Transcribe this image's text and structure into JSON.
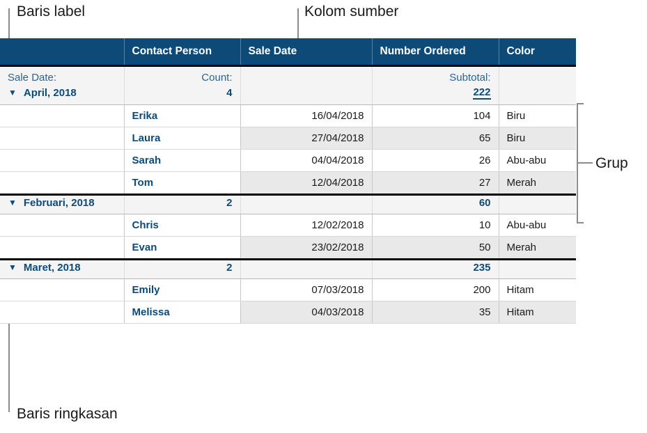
{
  "annotations": [
    {
      "id": "baris-label",
      "text": "Baris label"
    },
    {
      "id": "kolom-sumber",
      "text": "Kolom sumber"
    },
    {
      "id": "grup",
      "text": "Grup"
    },
    {
      "id": "baris-ringkasan",
      "text": "Baris ringkasan"
    }
  ],
  "colors": {
    "header_blue": "#0d4a78",
    "summary_text_blue": "#0d4a78",
    "label_text_blue": "#2c6391",
    "row_shade": "#e9e9e9",
    "summary_shade": "#f4f4f4",
    "leader_gray": "#8b8b8b"
  },
  "table": {
    "headers": [
      "",
      "Contact Person",
      "Sale Date",
      "Number Ordered",
      "Color"
    ],
    "label_row": {
      "col1": "Sale Date:",
      "col2": "Count:",
      "col3": "",
      "col4": "Subtotal:",
      "col5": ""
    },
    "disclosure_icon": "▼",
    "groups": [
      {
        "name": "April, 2018",
        "count": "4",
        "subtotal": "222",
        "subtotal_underlined": true,
        "rows": [
          {
            "person": "Erika",
            "date": "16/04/2018",
            "number": "104",
            "color": "Biru"
          },
          {
            "person": "Laura",
            "date": "27/04/2018",
            "number": "65",
            "color": "Biru"
          },
          {
            "person": "Sarah",
            "date": "04/04/2018",
            "number": "26",
            "color": "Abu-abu"
          },
          {
            "person": "Tom",
            "date": "12/04/2018",
            "number": "27",
            "color": "Merah"
          }
        ]
      },
      {
        "name": "Februari, 2018",
        "count": "2",
        "subtotal": "60",
        "subtotal_underlined": false,
        "rows": [
          {
            "person": "Chris",
            "date": "12/02/2018",
            "number": "10",
            "color": "Abu-abu"
          },
          {
            "person": "Evan",
            "date": "23/02/2018",
            "number": "50",
            "color": "Merah"
          }
        ]
      },
      {
        "name": "Maret, 2018",
        "count": "2",
        "subtotal": "235",
        "subtotal_underlined": false,
        "rows": [
          {
            "person": "Emily",
            "date": "07/03/2018",
            "number": "200",
            "color": "Hitam"
          },
          {
            "person": "Melissa",
            "date": "04/03/2018",
            "number": "35",
            "color": "Hitam"
          }
        ]
      }
    ]
  }
}
